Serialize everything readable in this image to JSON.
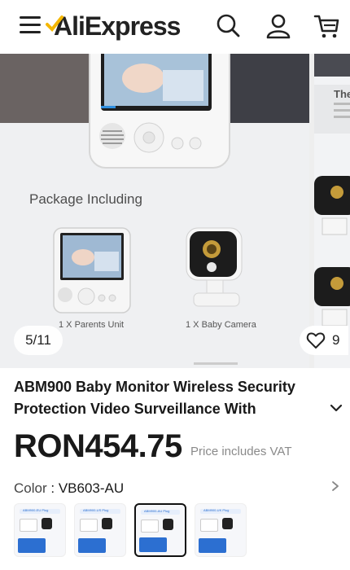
{
  "header": {
    "logo_text": "AliExpress",
    "brand_color": "#f5b700",
    "icons": [
      "menu-icon",
      "search-icon",
      "account-icon",
      "cart-icon"
    ]
  },
  "gallery": {
    "counter": "5/11",
    "package_heading": "Package Including",
    "item1_caption": "1 X Parents Unit",
    "item2_caption": "1 X Baby Camera",
    "next_slide_text": "The",
    "wishlist_count": "9"
  },
  "product": {
    "title": "ABM900 Baby Monitor Wireless Security Protection Video Surveillance With",
    "price": "RON454.75",
    "vat_note": "Price includes VAT"
  },
  "color": {
    "label": "Color",
    "selected": "VB603-AU",
    "options": [
      {
        "caption": "ABM900-EU Plug"
      },
      {
        "caption": "ABM900-US Plug"
      },
      {
        "caption": "ABM900-AU Plug"
      },
      {
        "caption": "ABM900-UK Plug"
      }
    ],
    "selected_index": 2
  }
}
